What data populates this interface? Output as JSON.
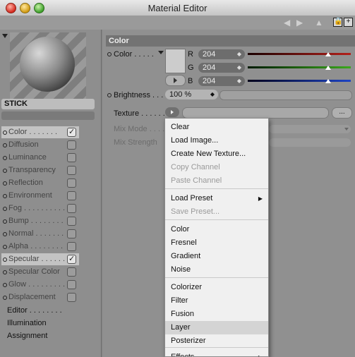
{
  "window": {
    "title": "Material Editor"
  },
  "toolbar": {
    "back_icon": "◀",
    "forward_icon": "▶",
    "up_icon": "▲"
  },
  "material": {
    "name": "STICK"
  },
  "channels": [
    {
      "label": "Color",
      "dots": "Color . . . . . . .",
      "checked": true,
      "selected": true
    },
    {
      "label": "Diffusion",
      "dots": "Diffusion",
      "checked": false,
      "selected": false
    },
    {
      "label": "Luminance",
      "dots": "Luminance",
      "checked": false,
      "selected": false
    },
    {
      "label": "Transparency",
      "dots": "Transparency",
      "checked": false,
      "selected": false
    },
    {
      "label": "Reflection",
      "dots": "Reflection",
      "checked": false,
      "selected": false
    },
    {
      "label": "Environment",
      "dots": "Environment",
      "checked": false,
      "selected": false
    },
    {
      "label": "Fog",
      "dots": "Fog . . . . . . . . . .",
      "checked": false,
      "selected": false
    },
    {
      "label": "Bump",
      "dots": "Bump . . . . . . . . .",
      "checked": false,
      "selected": false
    },
    {
      "label": "Normal",
      "dots": "Normal . . . . . . . .",
      "checked": false,
      "selected": false
    },
    {
      "label": "Alpha",
      "dots": "Alpha . . . . . . . . .",
      "checked": false,
      "selected": false
    },
    {
      "label": "Specular",
      "dots": "Specular . . . . . .",
      "checked": true,
      "selected": true
    },
    {
      "label": "Specular Color",
      "dots": "Specular Color",
      "checked": false,
      "selected": false
    },
    {
      "label": "Glow",
      "dots": "Glow . . . . . . . . . .",
      "checked": false,
      "selected": false
    },
    {
      "label": "Displacement",
      "dots": "Displacement",
      "checked": false,
      "selected": false
    }
  ],
  "extra_items": [
    {
      "label": "Editor . . . . . . . ."
    },
    {
      "label": "Illumination"
    },
    {
      "label": "Assignment"
    }
  ],
  "color_section": {
    "header": "Color",
    "color_label": "Color . . . . .",
    "swatch_color": "#cccccc",
    "r_label": "R",
    "r_value": "204",
    "g_label": "G",
    "g_value": "204",
    "b_label": "B",
    "b_value": "204",
    "brightness_label": "Brightness . . .",
    "brightness_value": "100 %",
    "texture_label": "Texture . . . . . .",
    "texture_more": "...",
    "mix_mode_label": "Mix Mode . . . .",
    "mix_strength_label": "Mix Strength"
  },
  "texture_menu": {
    "items": [
      {
        "label": "Clear",
        "disabled": false
      },
      {
        "label": "Load Image...",
        "disabled": false
      },
      {
        "label": "Create New Texture...",
        "disabled": false
      },
      {
        "label": "Copy Channel",
        "disabled": true
      },
      {
        "label": "Paste Channel",
        "disabled": true
      },
      {
        "label": "Load Preset",
        "disabled": false,
        "submenu": true
      },
      {
        "label": "Save Preset...",
        "disabled": true
      },
      {
        "label": "Color",
        "disabled": false
      },
      {
        "label": "Fresnel",
        "disabled": false
      },
      {
        "label": "Gradient",
        "disabled": false
      },
      {
        "label": "Noise",
        "disabled": false
      },
      {
        "label": "Colorizer",
        "disabled": false
      },
      {
        "label": "Filter",
        "disabled": false
      },
      {
        "label": "Fusion",
        "disabled": false
      },
      {
        "label": "Layer",
        "disabled": false,
        "highlighted": true
      },
      {
        "label": "Posterizer",
        "disabled": false
      },
      {
        "label": "Effects",
        "disabled": false,
        "submenu": true
      }
    ]
  }
}
